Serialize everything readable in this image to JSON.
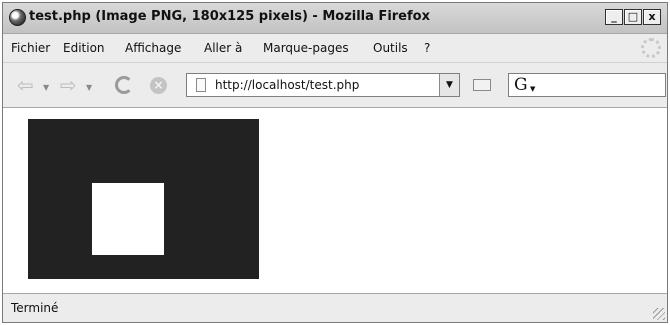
{
  "window": {
    "title": "test.php (Image PNG, 180x125 pixels) - Mozilla Firefox",
    "controls": {
      "minimize": "_",
      "maximize": "□",
      "close": "x"
    }
  },
  "menu": {
    "items": [
      {
        "label": "Fichier"
      },
      {
        "label": "Edition"
      },
      {
        "label": "Affichage"
      },
      {
        "label": "Aller à"
      },
      {
        "label": "Marque-pages"
      },
      {
        "label": "Outils"
      },
      {
        "label": "?"
      }
    ]
  },
  "toolbar": {
    "back_icon": "back-arrow-icon",
    "forward_icon": "forward-arrow-icon",
    "reload_icon": "reload-icon",
    "stop_icon": "stop-icon",
    "address": "http://localhost/test.php",
    "search_value": "",
    "search_engine_glyph": "G"
  },
  "content": {
    "image_background": "#222222",
    "inner_square": "#ffffff"
  },
  "status": {
    "text": "Terminé"
  },
  "colors": {
    "chrome": "#ececec",
    "content": "#ffffff"
  }
}
